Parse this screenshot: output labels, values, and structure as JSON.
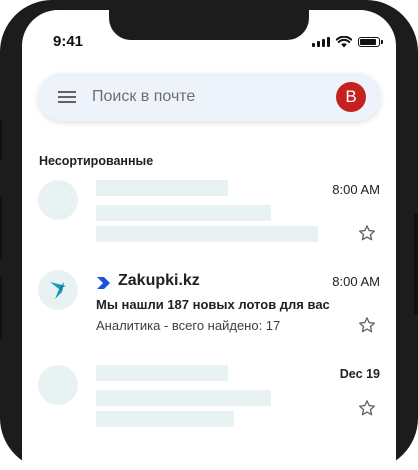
{
  "status_bar": {
    "time": "9:41"
  },
  "search": {
    "placeholder": "Поиск в почте",
    "avatar_letter": "B"
  },
  "inbox": {
    "section_title": "Несортированные",
    "items": [
      {
        "time": "8:00 AM"
      },
      {
        "sender": "Zakupki.kz",
        "subject": "Мы нашли 187 новых лотов для вас",
        "snippet": "Аналитика - всего найдено: 17",
        "time": "8:00 AM"
      },
      {
        "time": "Dec 19"
      }
    ]
  },
  "colors": {
    "avatar_bg": "#c5221f",
    "brand_arrow": "#1a56db",
    "skeleton": "#e9f2f3"
  },
  "icons": [
    "menu-icon",
    "wifi-icon",
    "battery-icon",
    "star-icon",
    "chevron-right-icon",
    "bird-logo-icon"
  ]
}
